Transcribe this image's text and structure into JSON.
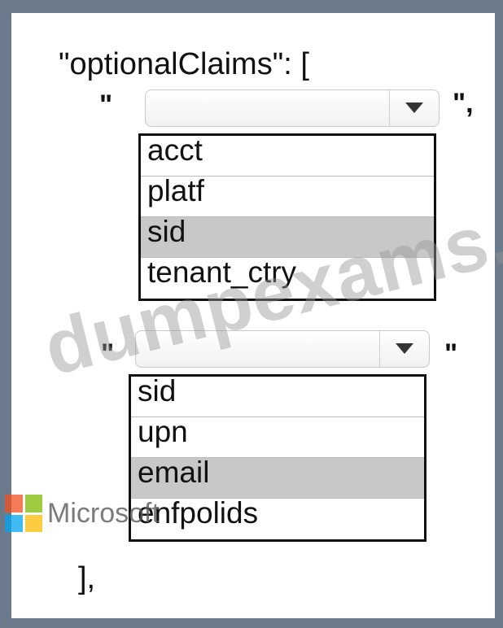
{
  "code": {
    "open_line": "\"optionalClaims\": [",
    "close_line": "],"
  },
  "quotes": {
    "q1_open": "\"",
    "q1_close": "\",",
    "q2_open": "\"",
    "q2_close": "\""
  },
  "dropdown1": {
    "selected": "",
    "options": [
      "acct",
      "platf",
      "sid",
      "tenant_ctry"
    ],
    "highlighted_index": 2
  },
  "dropdown2": {
    "selected": "",
    "options": [
      "sid",
      "upn",
      "email",
      "enfpolids"
    ],
    "highlighted_index": 2
  },
  "watermark": {
    "text": "dumpexams.com",
    "brand_text": "Microsoft"
  },
  "colors": {
    "frame": "#6b7b8c",
    "highlight": "#c8c8c8",
    "ms_red": "#f25022",
    "ms_green": "#7fba00",
    "ms_blue": "#00a4ef",
    "ms_yellow": "#ffb900"
  }
}
